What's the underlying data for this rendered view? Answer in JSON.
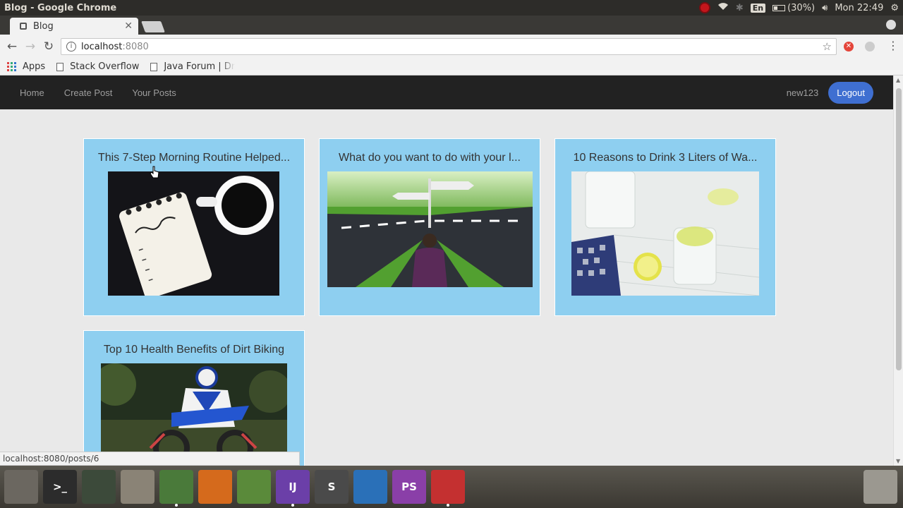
{
  "os": {
    "window_title": "Blog - Google Chrome",
    "lang": "En",
    "battery": "(30%)",
    "clock": "Mon 22:49"
  },
  "browser": {
    "tab_title": "Blog",
    "url_host": "localhost",
    "url_port": ":8080",
    "bookmarks": [
      "Apps",
      "Stack Overflow",
      "Java Forum | Dr"
    ],
    "status_url": "localhost:8080/posts/6"
  },
  "site": {
    "nav": [
      "Home",
      "Create Post",
      "Your Posts"
    ],
    "username": "new123",
    "logout_label": "Logout"
  },
  "posts": [
    {
      "title": "This 7-Step Morning Routine Helped...",
      "image": "todo-list-and-coffee"
    },
    {
      "title": "What do you want to do with your l...",
      "image": "crossroads"
    },
    {
      "title": "10 Reasons to Drink 3 Liters of Wa...",
      "image": "water-with-lemon"
    },
    {
      "title": "Top 10 Health Benefits of Dirt Biking",
      "image": "dirt-bike-rider"
    }
  ],
  "dock": [
    {
      "name": "ubuntu-dash-icon",
      "label": "",
      "color": "#6b6760"
    },
    {
      "name": "terminal-icon",
      "label": ">_",
      "color": "#2c2c2c"
    },
    {
      "name": "system-monitor-icon",
      "label": "",
      "color": "#3c4a3a"
    },
    {
      "name": "files-icon",
      "label": "",
      "color": "#8a8376"
    },
    {
      "name": "chrome-icon",
      "label": "",
      "color": "#4a7a3a"
    },
    {
      "name": "firefox-icon",
      "label": "",
      "color": "#d56a1c"
    },
    {
      "name": "android-studio-icon",
      "label": "",
      "color": "#5a8a3a"
    },
    {
      "name": "intellij-icon",
      "label": "IJ",
      "color": "#6b3fa8"
    },
    {
      "name": "sublime-icon",
      "label": "S",
      "color": "#4a4a4a"
    },
    {
      "name": "vscode-icon",
      "label": "",
      "color": "#2a70b8"
    },
    {
      "name": "phpstorm-icon",
      "label": "PS",
      "color": "#8a3fa8"
    },
    {
      "name": "recorder-icon",
      "label": "",
      "color": "#c43030"
    }
  ]
}
